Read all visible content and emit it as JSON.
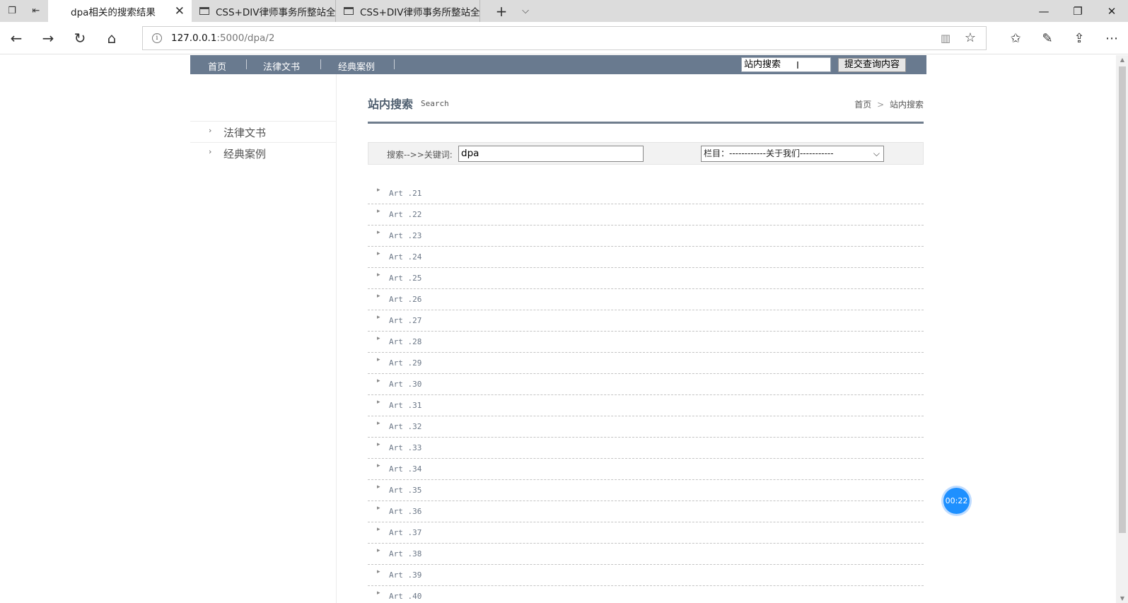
{
  "browser": {
    "tabs": [
      {
        "title": "dpa相关的搜索结果",
        "active": true
      },
      {
        "title": "CSS+DIV律师事务所整站全:",
        "active": false
      },
      {
        "title": "CSS+DIV律师事务所整站全:",
        "active": false
      }
    ],
    "url_host": "127.0.0.1",
    "url_path": ":5000/dpa/2"
  },
  "topnav": {
    "items": [
      "首页",
      "法律文书",
      "经典案例"
    ],
    "search_value": "站内搜索",
    "submit_label": "提交查询内容"
  },
  "sidebar": {
    "items": [
      "法律文书",
      "经典案例"
    ]
  },
  "main": {
    "title": "站内搜索",
    "subtitle": "Search",
    "breadcrumb": {
      "home": "首页",
      "sep": ">",
      "current": "站内搜索"
    },
    "search": {
      "label": "搜索-->>关键词:",
      "keyword": "dpa",
      "column_select": "栏目：------------关于我们-----------"
    },
    "articles": [
      "Art .21",
      "Art .22",
      "Art .23",
      "Art .24",
      "Art .25",
      "Art .26",
      "Art .27",
      "Art .28",
      "Art .29",
      "Art .30",
      "Art .31",
      "Art .32",
      "Art .33",
      "Art .34",
      "Art .35",
      "Art .36",
      "Art .37",
      "Art .38",
      "Art .39",
      "Art .40"
    ]
  },
  "timer": "00:22",
  "colors": {
    "nav_bg": "#697a8f",
    "accent_line": "#6f7d8d",
    "timer_bg": "#1e90ff"
  }
}
